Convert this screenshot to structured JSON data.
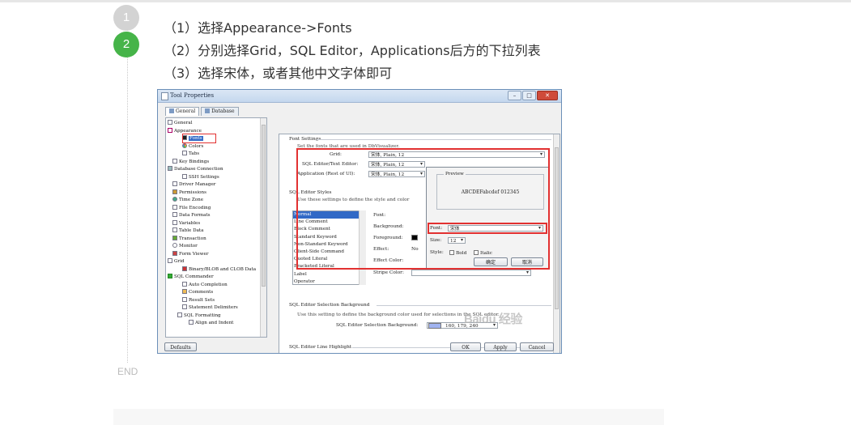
{
  "steps": {
    "step1_number": "1",
    "step2_number": "2",
    "end_label": "END",
    "line1": "（1）选择Appearance->Fonts",
    "line2": "（2）分别选择Grid，SQL Editor，Applications后方的下拉列表",
    "line3": "（3）选择宋体，或者其他中文字体即可"
  },
  "colors": {
    "step_active": "#46b449",
    "step_inactive": "#d3d3d3",
    "highlight_box": "#e23131",
    "selection": "#3169c6"
  },
  "window": {
    "title": "Tool Properties",
    "tabs": [
      "General",
      "Database"
    ],
    "minimize": "–",
    "maximize": "□",
    "close": "✕"
  },
  "tree": [
    {
      "label": "General",
      "icon": "page-icon"
    },
    {
      "label": "Appearance",
      "icon": "brush-icon"
    },
    {
      "label": "Fonts",
      "icon": "font-icon"
    },
    {
      "label": "Colors",
      "icon": "palette-icon"
    },
    {
      "label": "Tabs",
      "icon": "tab-icon"
    },
    {
      "label": "Key Bindings",
      "icon": "key-icon"
    },
    {
      "label": "Database Connection",
      "icon": "database-icon"
    },
    {
      "label": "SSH Settings",
      "icon": "ssh-icon"
    },
    {
      "label": "Driver Manager",
      "icon": "driver-icon"
    },
    {
      "label": "Permissions",
      "icon": "permission-icon"
    },
    {
      "label": "Time Zone",
      "icon": "globe-icon"
    },
    {
      "label": "File Encoding",
      "icon": "file-icon"
    },
    {
      "label": "Data Formats",
      "icon": "format-icon"
    },
    {
      "label": "Variables",
      "icon": "variable-icon"
    },
    {
      "label": "Table Data",
      "icon": "table-icon"
    },
    {
      "label": "Transaction",
      "icon": "transaction-icon"
    },
    {
      "label": "Monitor",
      "icon": "monitor-icon"
    },
    {
      "label": "Form Viewer",
      "icon": "form-icon"
    },
    {
      "label": "Grid",
      "icon": "grid-icon"
    },
    {
      "label": "Binary/BLOB and CLOB Data",
      "icon": "blob-icon"
    },
    {
      "label": "SQL Commander",
      "icon": "play-icon"
    },
    {
      "label": "Auto Completion",
      "icon": "completion-icon"
    },
    {
      "label": "Comments",
      "icon": "comment-icon"
    },
    {
      "label": "Result Sets",
      "icon": "result-icon"
    },
    {
      "label": "Statement Delimiters",
      "icon": "delimiter-icon"
    },
    {
      "label": "SQL Formatting",
      "icon": "format-sql-icon"
    },
    {
      "label": "Align and Indent",
      "icon": "indent-icon"
    }
  ],
  "font_settings": {
    "section": "Font Settings",
    "description": "Set the fonts that are used in DbVisualizer.",
    "grid_label": "Grid:",
    "grid_value": "宋体, Plain, 12",
    "sql_editor_label": "SQL Editor/Text Editor:",
    "sql_editor_value": "宋体, Plain, 12",
    "application_label": "Application (Rest of UI):",
    "application_value": "宋体, Plain, 12"
  },
  "editor_styles": {
    "section": "SQL Editor Styles",
    "description": "Use these settings to define the style and color",
    "styles": [
      "Normal",
      "Line Comment",
      "Block Comment",
      "Standard Keyword",
      "Non-Standard Keyword",
      "Client-Side Command",
      "Quoted Literal",
      "Bracketed Literal",
      "Label",
      "Operator"
    ],
    "font_label": "Font:",
    "background_label": "Background:",
    "foreground_label": "Foreground:",
    "effect_label": "Effect:",
    "effect_value": "No",
    "effect_color_label": "Effect Color:",
    "stripe_color_label": "Stripe Color:"
  },
  "font_dialog": {
    "preview_label": "Preview",
    "preview_text": "ABCDEFabcdef 012345",
    "font_label": "Font:",
    "font_value": "宋体",
    "size_label": "Size:",
    "size_value": "12",
    "style_label": "Style:",
    "bold": "Bold",
    "italic": "Italic",
    "ok": "确定",
    "cancel": "取消"
  },
  "selection_background": {
    "section": "SQL Editor Selection Background",
    "description": "Use this setting to define the background color used for selections in the SQL editor.",
    "label": "SQL Editor Selection Background:",
    "value": "160, 179, 240",
    "swatch_color": "#a0b3f0"
  },
  "line_highlight": {
    "section": "SQL Editor Line Highlight"
  },
  "buttons": {
    "defaults": "Defaults",
    "ok": "OK",
    "apply": "Apply",
    "cancel": "Cancel"
  },
  "watermark": "Baidu 经验"
}
